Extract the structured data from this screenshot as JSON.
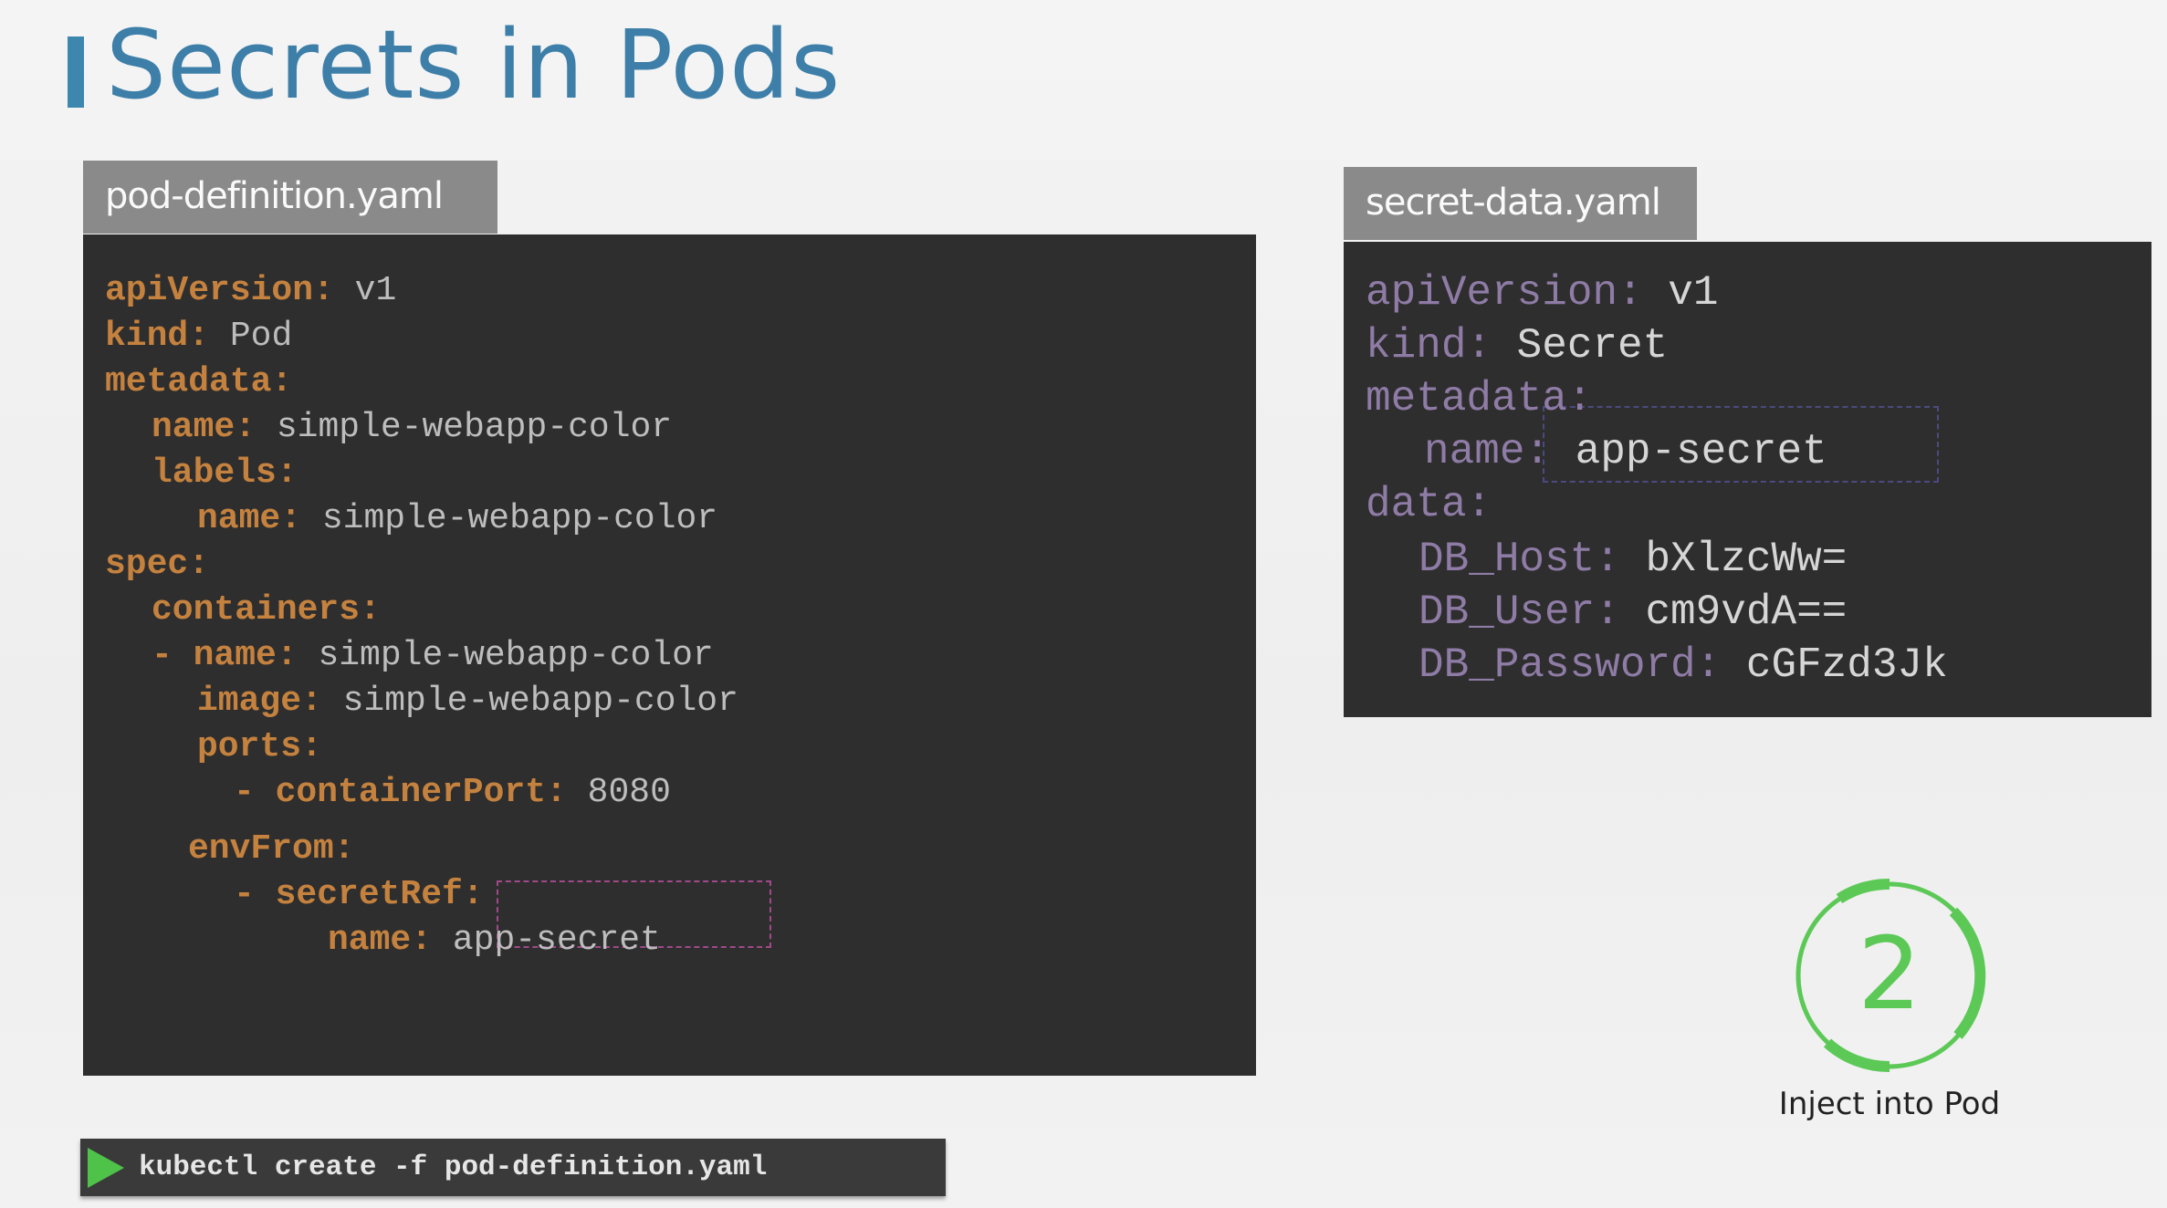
{
  "slide": {
    "title": "Secrets in Pods",
    "accent_color": "#3d86ae"
  },
  "pod_file": {
    "filename": "pod-definition.yaml",
    "lines": [
      {
        "key": "apiVersion:",
        "value": " v1"
      },
      {
        "key": "kind:",
        "value": " Pod"
      },
      {
        "key": "metadata:",
        "value": ""
      },
      {
        "key": "name:",
        "value": " simple-webapp-color"
      },
      {
        "key": "labels:",
        "value": ""
      },
      {
        "key": "name:",
        "value": " simple-webapp-color"
      },
      {
        "key": "spec:",
        "value": ""
      },
      {
        "key": "containers:",
        "value": ""
      },
      {
        "key": "- name:",
        "value": " simple-webapp-color"
      },
      {
        "key": "image:",
        "value": " simple-webapp-color"
      },
      {
        "key": "ports:",
        "value": ""
      },
      {
        "key": "- containerPort:",
        "value": " 8080"
      },
      {
        "key": "envFrom:",
        "value": ""
      },
      {
        "key": "- secretRef:",
        "value": ""
      },
      {
        "key": "name:",
        "value": " app-secret"
      }
    ]
  },
  "secret_file": {
    "filename": "secret-data.yaml",
    "lines": [
      {
        "key": "apiVersion:",
        "value": " v1"
      },
      {
        "key": "kind:",
        "value": " Secret"
      },
      {
        "key": "metadata:",
        "value": ""
      },
      {
        "key": "name:",
        "value": " app-secret"
      },
      {
        "key": "data:",
        "value": ""
      },
      {
        "key": "DB_Host:",
        "value": " bXlzcWw="
      },
      {
        "key": "DB_User:",
        "value": " cm9vdA=="
      },
      {
        "key": "DB_Password:",
        "value": " cGFzd3Jk"
      }
    ]
  },
  "step": {
    "number": "2",
    "label": "Inject into Pod",
    "color": "#5cc957"
  },
  "command": {
    "icon": "play-icon",
    "text": "kubectl create -f pod-definition.yaml"
  }
}
